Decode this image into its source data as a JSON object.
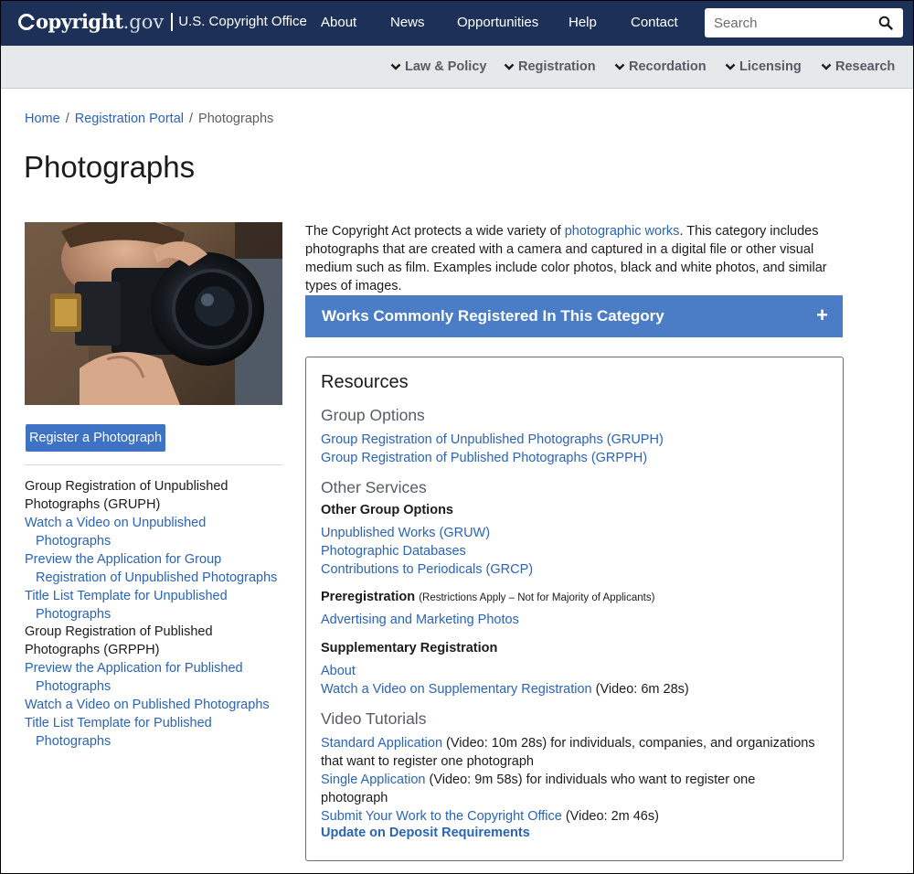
{
  "header": {
    "logo_copy": "opyright",
    "logo_gov": ".gov",
    "office": "U.S. Copyright Office",
    "nav": [
      "About",
      "News",
      "Opportunities",
      "Help",
      "Contact"
    ],
    "search_placeholder": "Search"
  },
  "subnav": [
    "Law & Policy",
    "Registration",
    "Recordation",
    "Licensing",
    "Research"
  ],
  "breadcrumb": [
    "Home",
    "Registration Portal",
    "Photographs"
  ],
  "page_title": "Photographs",
  "left": {
    "register_button": "Register a Photograph",
    "group1": {
      "heading": "Group Registration of Unpublished Photographs (GRUPH)",
      "links": [
        "Watch a Video on Unpublished Photographs",
        "Preview the Application for Group Registration of Unpublished Photographs",
        "Title List Template for Unpublished Photographs"
      ]
    },
    "group2": {
      "heading": "Group Registration of Published Photographs (GRPPH)",
      "links": [
        "Preview the Application for Published Photographs",
        "Watch a Video on Published Photographs",
        "Title List Template for Published Photographs"
      ]
    }
  },
  "intro": {
    "before": "The Copyright Act protects a wide variety of ",
    "link": "photographic works",
    "after": ". This category includes photographs that are created with a camera and captured in a digital file or other visual medium such as film. Examples include color photos, black and white photos, and similar types of images."
  },
  "accordion": {
    "label": "Works Commonly Registered In This Category",
    "icon": "+"
  },
  "resources": {
    "title": "Resources",
    "group_options": {
      "heading": "Group Options",
      "links": [
        "Group Registration of Unpublished Photographs (GRUPH)",
        "Group Registration of Published Photographs (GRPPH)"
      ]
    },
    "other_services": {
      "heading": "Other Services",
      "other_group_heading": "Other Group Options",
      "other_group_links": [
        "Unpublished Works (GRUW)",
        "Photographic Databases",
        "Contributions to Periodicals (GRCP)"
      ],
      "prereg_heading": "Preregistration",
      "prereg_note": "(Restrictions Apply – Not for Majority of Applicants)",
      "prereg_link": "Advertising and Marketing Photos",
      "supp_heading": "Supplementary Registration",
      "supp_about": "About",
      "supp_video_link": "Watch a Video on Supplementary Registration",
      "supp_video_note": " (Video: 6m 28s)"
    },
    "video_tutorials": {
      "heading": "Video Tutorials",
      "items": [
        {
          "link": "Standard Application",
          "text": " (Video: 10m 28s) for individuals, companies, and organizations that want to register one photograph"
        },
        {
          "link": "Single Application",
          "text": " (Video: 9m 58s) for individuals who want to register one photograph"
        },
        {
          "link": "Submit Your Work to the Copyright Office",
          "text": " (Video: 2m 46s)"
        }
      ]
    },
    "deposit_link": "Update on Deposit Requirements"
  },
  "colors": {
    "header_bg": "#1d3158",
    "subnav_bg": "#e6e8ea",
    "link": "#2a64b5",
    "accordion_bg": "#4a7dc6",
    "button_bg": "#3d72c4"
  },
  "icons": {
    "search": "search-icon",
    "chevron": "chevron-down-icon",
    "expand": "plus-icon"
  }
}
